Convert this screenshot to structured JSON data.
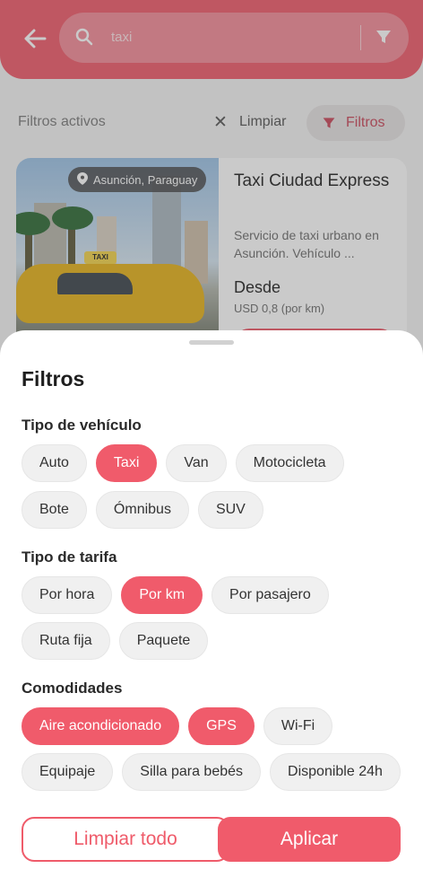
{
  "search": {
    "query": "taxi"
  },
  "active_filters": {
    "label": "Filtros activos",
    "clear_label": "Limpiar",
    "filters_button_label": "Filtros"
  },
  "listing": {
    "location": "Asunción, Paraguay",
    "title": "Taxi Ciudad Express",
    "description": "Servicio de taxi urbano en Asunción. Vehículo ...",
    "from_label": "Desde",
    "price": "USD  0,8 (por km)",
    "image_sign_text": "TAXI"
  },
  "sheet": {
    "title": "Filtros",
    "sections": [
      {
        "title": "Tipo de vehículo",
        "rows": [
          [
            {
              "label": "Auto",
              "selected": false
            },
            {
              "label": "Taxi",
              "selected": true
            },
            {
              "label": "Van",
              "selected": false
            },
            {
              "label": "Motocicleta",
              "selected": false
            }
          ],
          [
            {
              "label": "Bote",
              "selected": false
            },
            {
              "label": "Ómnibus",
              "selected": false
            },
            {
              "label": "SUV",
              "selected": false
            }
          ]
        ]
      },
      {
        "title": "Tipo de tarifa",
        "rows": [
          [
            {
              "label": "Por hora",
              "selected": false
            },
            {
              "label": "Por km",
              "selected": true
            },
            {
              "label": "Por pasajero",
              "selected": false
            }
          ],
          [
            {
              "label": "Ruta fija",
              "selected": false
            },
            {
              "label": "Paquete",
              "selected": false
            }
          ]
        ]
      },
      {
        "title": "Comodidades",
        "rows": [
          [
            {
              "label": "Aire acondicionado",
              "selected": true
            },
            {
              "label": "GPS",
              "selected": true
            },
            {
              "label": "Wi-Fi",
              "selected": false
            }
          ],
          [
            {
              "label": "Equipaje",
              "selected": false
            },
            {
              "label": "Silla para bebés",
              "selected": false
            },
            {
              "label": "Disponible 24h",
              "selected": false
            }
          ]
        ]
      }
    ],
    "clear_all_label": "Limpiar todo",
    "apply_label": "Aplicar"
  },
  "colors": {
    "accent": "#f05b6b",
    "accent_dark": "#c9475a",
    "chip_bg": "#f0f0f0"
  },
  "icons": [
    "back-arrow-icon",
    "search-icon",
    "filter-funnel-icon",
    "close-icon",
    "location-pin-icon"
  ]
}
